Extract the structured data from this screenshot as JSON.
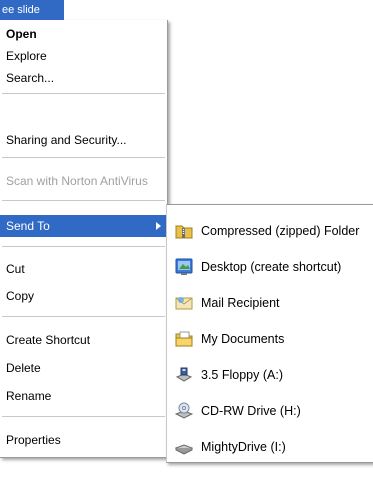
{
  "selected_file": {
    "label": "ee slide"
  },
  "context_menu": {
    "items": [
      {
        "label": "Open"
      },
      {
        "label": "Explore"
      },
      {
        "label": "Search..."
      },
      {
        "label": "Sharing and Security..."
      },
      {
        "label": "Scan with Norton AntiVirus"
      },
      {
        "label": "Send To"
      },
      {
        "label": "Cut"
      },
      {
        "label": "Copy"
      },
      {
        "label": "Create Shortcut"
      },
      {
        "label": "Delete"
      },
      {
        "label": "Rename"
      },
      {
        "label": "Properties"
      }
    ]
  },
  "send_to_menu": {
    "items": [
      {
        "label": "Compressed (zipped) Folder",
        "icon": "zip-folder-icon"
      },
      {
        "label": "Desktop (create shortcut)",
        "icon": "desktop-icon"
      },
      {
        "label": "Mail Recipient",
        "icon": "mail-icon"
      },
      {
        "label": "My Documents",
        "icon": "documents-folder-icon"
      },
      {
        "label": "3.5 Floppy (A:)",
        "icon": "floppy-drive-icon"
      },
      {
        "label": "CD-RW Drive (H:)",
        "icon": "cd-drive-icon"
      },
      {
        "label": "MightyDrive (I:)",
        "icon": "removable-drive-icon"
      }
    ]
  },
  "colors": {
    "highlight": "#316ac5",
    "disabled_text": "#a0a0a0",
    "separator": "#c8c8c8"
  }
}
